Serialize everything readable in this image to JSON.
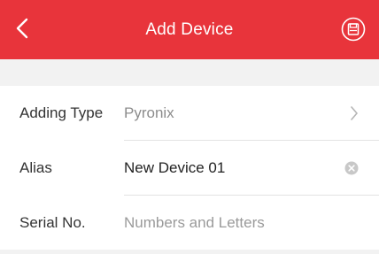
{
  "header": {
    "title": "Add Device",
    "back_icon": "chevron-left-icon",
    "save_icon": "save-circle-icon",
    "color": "#e8343b"
  },
  "form": {
    "adding_type": {
      "label": "Adding Type",
      "value": "Pyronix",
      "icon": "chevron-right-icon"
    },
    "alias": {
      "label": "Alias",
      "value": "New Device 01",
      "icon": "clear-icon"
    },
    "serial": {
      "label": "Serial No.",
      "placeholder": "Numbers and Letters"
    }
  }
}
